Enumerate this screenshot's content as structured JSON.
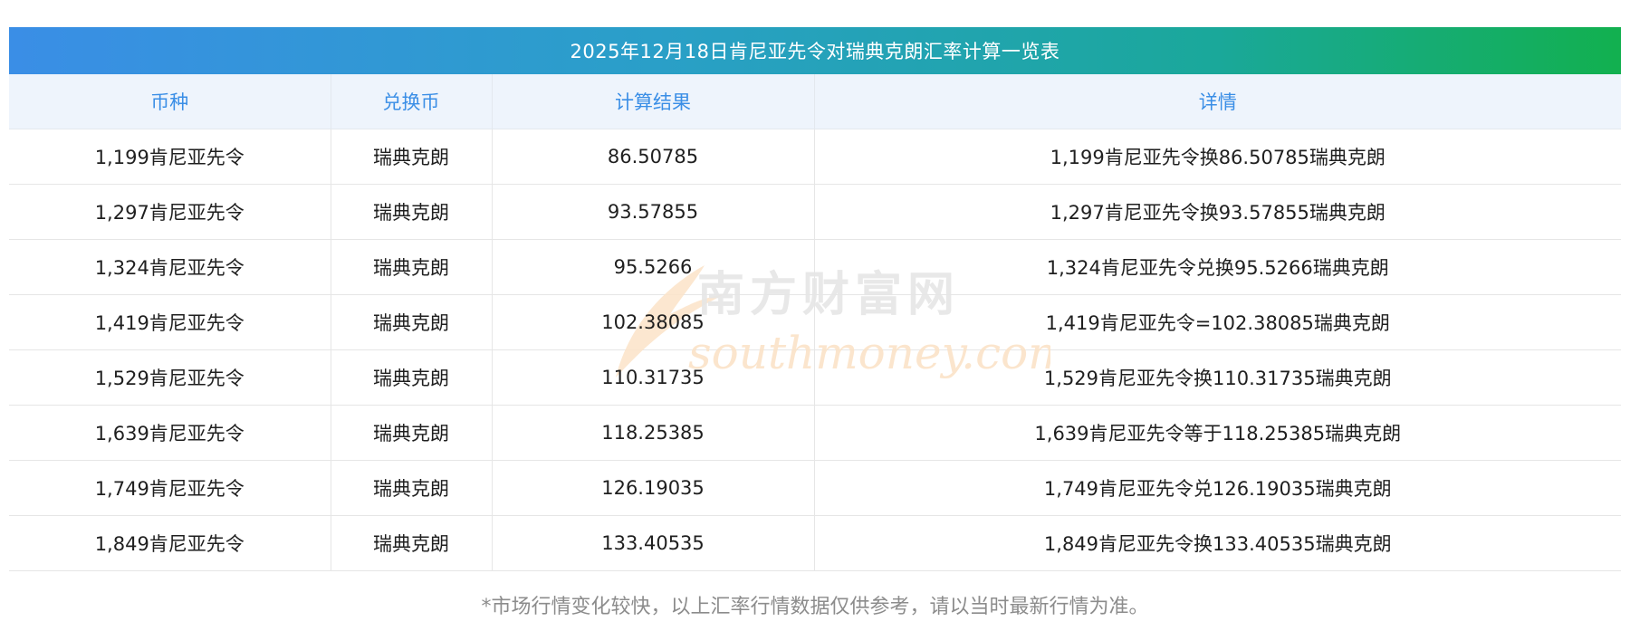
{
  "title": "2025年12月18日肯尼亚先令对瑞典克朗汇率计算一览表",
  "headers": [
    "币种",
    "兑换币",
    "计算结果",
    "详情"
  ],
  "rows": [
    {
      "currency": "1,199肯尼亚先令",
      "target": "瑞典克朗",
      "result": "86.50785",
      "detail": "1,199肯尼亚先令换86.50785瑞典克朗"
    },
    {
      "currency": "1,297肯尼亚先令",
      "target": "瑞典克朗",
      "result": "93.57855",
      "detail": "1,297肯尼亚先令换93.57855瑞典克朗"
    },
    {
      "currency": "1,324肯尼亚先令",
      "target": "瑞典克朗",
      "result": "95.5266",
      "detail": "1,324肯尼亚先令兑换95.5266瑞典克朗"
    },
    {
      "currency": "1,419肯尼亚先令",
      "target": "瑞典克朗",
      "result": "102.38085",
      "detail": "1,419肯尼亚先令=102.38085瑞典克朗"
    },
    {
      "currency": "1,529肯尼亚先令",
      "target": "瑞典克朗",
      "result": "110.31735",
      "detail": "1,529肯尼亚先令换110.31735瑞典克朗"
    },
    {
      "currency": "1,639肯尼亚先令",
      "target": "瑞典克朗",
      "result": "118.25385",
      "detail": "1,639肯尼亚先令等于118.25385瑞典克朗"
    },
    {
      "currency": "1,749肯尼亚先令",
      "target": "瑞典克朗",
      "result": "126.19035",
      "detail": "1,749肯尼亚先令兑126.19035瑞典克朗"
    },
    {
      "currency": "1,849肯尼亚先令",
      "target": "瑞典克朗",
      "result": "133.40535",
      "detail": "1,849肯尼亚先令换133.40535瑞典克朗"
    }
  ],
  "watermark": {
    "cn": "南方财富网",
    "en": "southmoney.com"
  },
  "footnote": "*市场行情变化较快，以上汇率行情数据仅供参考，请以当时最新行情为准。",
  "colors": {
    "header_text": "#3a8ee6",
    "header_bg": "#eef4fc",
    "gradient_start": "#3a8ee6",
    "gradient_end": "#12b04f"
  }
}
